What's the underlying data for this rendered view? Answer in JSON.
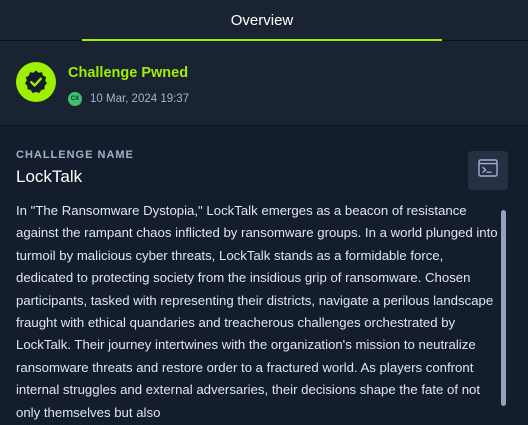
{
  "tabs": {
    "active_label": "Overview"
  },
  "status": {
    "title": "Challenge Pwned",
    "user_initials": "CX",
    "date": "10 Mar, 2024 19:37"
  },
  "challenge": {
    "section_label": "CHALLENGE NAME",
    "name": "LockTalk",
    "description": "In \"The Ransomware Dystopia,\" LockTalk emerges as a beacon of resistance against the rampant chaos inflicted by ransomware groups. In a world plunged into turmoil by malicious cyber threats, LockTalk stands as a formidable force, dedicated to protecting society from the insidious grip of ransomware. Chosen participants, tasked with representing their districts, navigate a perilous landscape fraught with ethical quandaries and treacherous challenges orchestrated by LockTalk. Their journey intertwines with the organization's mission to neutralize ransomware threats and restore order to a fractured world. As players confront internal struggles and external adversaries, their decisions shape the fate of not only themselves but also"
  },
  "icons": {
    "pwned": "check-badge-icon",
    "terminal": "terminal-window-icon"
  },
  "colors": {
    "accent": "#9fef00",
    "background": "#141d2b",
    "panel": "#1a2332"
  }
}
